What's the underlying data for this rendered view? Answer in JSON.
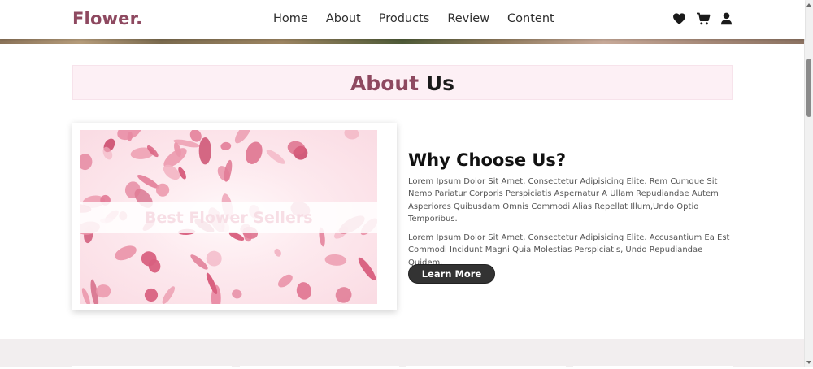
{
  "header": {
    "logo": "Flower.",
    "nav": [
      "Home",
      "About",
      "Products",
      "Review",
      "Content"
    ],
    "icons": [
      "heart-icon",
      "cart-icon",
      "user-icon"
    ]
  },
  "about": {
    "title_part1": "About",
    "title_part2": "Us",
    "video_caption": "Best Flower Sellers",
    "heading": "Why Choose Us?",
    "paragraph1": "Lorem Ipsum Dolor Sit Amet, Consectetur Adipisicing Elite. Rem Cumque Sit Nemo Pariatur Corporis Perspiciatis Aspernatur A Ullam Repudiandae Autem Asperiores Quibusdam Omnis Commodi Alias Repellat Illum,Undo Optio Temporibus.",
    "paragraph2": "Lorem Ipsum Dolor Sit Amet, Consectetur Adipisicing Elite. Accusantium Ea Est Commodi Incidunt Magni Quia Molestias Perspiciatis, Undo Repudiandae Quidem.",
    "button": "Learn More"
  },
  "colors": {
    "brand": "#8e4960",
    "title_bg": "#fdf0f5",
    "button_bg": "#333333",
    "section_bg": "#f2eeef"
  }
}
